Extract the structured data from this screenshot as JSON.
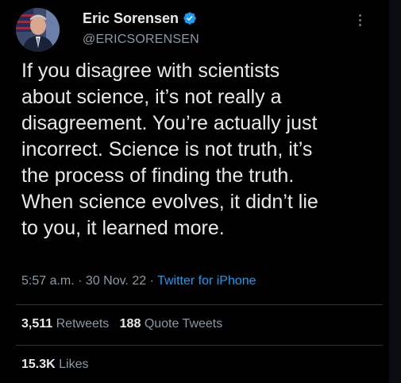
{
  "author": {
    "display_name": "Eric Sorensen",
    "handle": "@ERICSORENSEN",
    "verified": true,
    "avatar_icon": "user-avatar-photo",
    "verified_icon": "verified-badge-icon"
  },
  "tweet": {
    "text": "If you disagree with scientists\nabout science, it’s not really a\ndisagreement. You’re actually just\nincorrect. Science is not truth, it’s\nthe process of finding the truth.\nWhen science evolves, it didn’t lie\nto you, it learned more.",
    "time": "5:57 a.m.",
    "separator": " · ",
    "date": "30 Nov. 22",
    "source": "Twitter for iPhone"
  },
  "stats": {
    "retweets_count": "3,511",
    "retweets_label": "Retweets",
    "quotes_count": "188",
    "quotes_label": "Quote Tweets",
    "likes_count": "15.3K",
    "likes_label": "Likes"
  },
  "colors": {
    "background": "#000000",
    "text_primary": "#e7e9ea",
    "text_secondary": "#8b98a5",
    "link": "#1d9bf0",
    "divider": "#2f3336",
    "verified": "#1d9bf0"
  }
}
